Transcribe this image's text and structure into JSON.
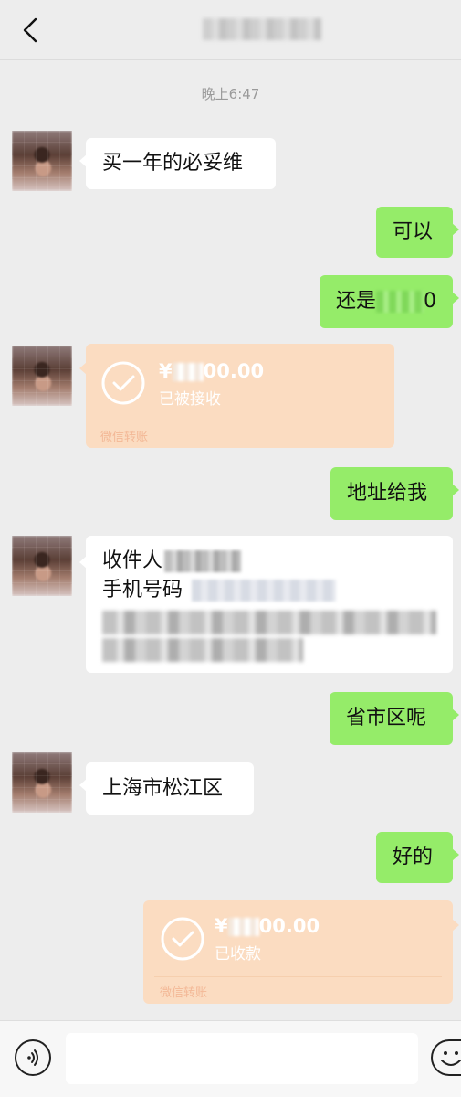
{
  "header": {
    "title": ""
  },
  "timestamp": "晚上6:47",
  "messages": {
    "m1": "买一年的必妥维",
    "m2": "可以",
    "m3_prefix": "还是",
    "m3_suffix": "0",
    "t1": {
      "amount_prefix": "¥",
      "amount_suffix": "00.00",
      "status": "已被接收",
      "footer": "微信转账"
    },
    "m4": "地址给我",
    "m5": {
      "recipient_label": "收件人",
      "phone_label": "手机号码"
    },
    "m6": "省市区呢",
    "m7": "上海市松江区",
    "m8": "好的",
    "t2": {
      "amount_prefix": "¥",
      "amount_suffix": "00.00",
      "status": "已收款",
      "footer": "微信转账"
    }
  },
  "colors": {
    "sent": "#95ec69",
    "received": "#ffffff",
    "transfer": "#fbdcc1",
    "background": "#ededed"
  },
  "icons": {
    "back": "chevron-left-icon",
    "voice": "voice-icon",
    "emoji": "emoji-icon",
    "check": "check-circle-icon"
  }
}
